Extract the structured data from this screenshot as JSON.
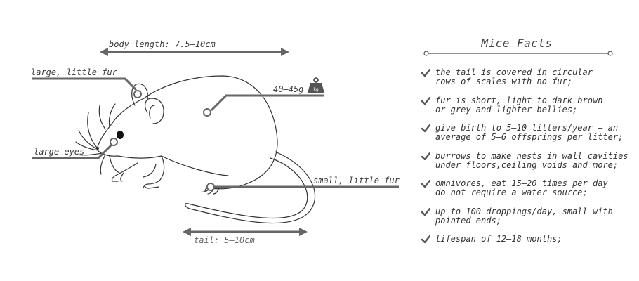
{
  "labels": {
    "body_length": "body length: 7.5–10cm",
    "ears": "large, little fur",
    "eyes": "large eyes",
    "weight": "40–45g",
    "weight_icon_text": "kg",
    "feet": "small, little fur",
    "tail": "tail: 5–10cm"
  },
  "facts": {
    "title": "Mice Facts",
    "items": [
      "the tail is covered in circular\nrows of scales with no fur;",
      "fur is short, light to dark brown\nor grey and lighter bellies;",
      "give birth to 5–10 litters/year – an\naverage of 5–6 offsprings per litter;",
      "burrows to make nests in wall cavities\nunder floors,ceiling voids and more;",
      "omnivores, eat 15–20 times per day\ndo not require a water source;",
      "up to 100 droppings/day, small with\npointed ends;",
      "lifespan of 12–18 months;"
    ]
  },
  "icons": [
    "weight-icon",
    "check-icon"
  ],
  "colors": {
    "line": "#666666",
    "ink": "#333333",
    "text": "#3a3a3a"
  }
}
